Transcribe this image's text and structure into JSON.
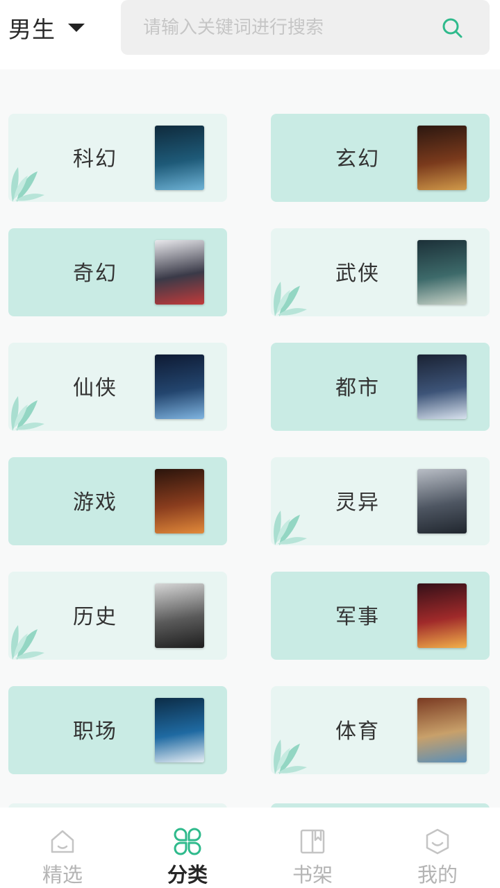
{
  "header": {
    "gender_label": "男生",
    "search_placeholder": "请输入关键词进行搜索"
  },
  "categories": [
    {
      "label": "科幻",
      "style": "light",
      "leaf": true
    },
    {
      "label": "玄幻",
      "style": "dark",
      "leaf": false
    },
    {
      "label": "奇幻",
      "style": "dark",
      "leaf": false
    },
    {
      "label": "武侠",
      "style": "light",
      "leaf": true
    },
    {
      "label": "仙侠",
      "style": "light",
      "leaf": true
    },
    {
      "label": "都市",
      "style": "dark",
      "leaf": false
    },
    {
      "label": "游戏",
      "style": "dark",
      "leaf": false
    },
    {
      "label": "灵异",
      "style": "light",
      "leaf": true
    },
    {
      "label": "历史",
      "style": "light",
      "leaf": true
    },
    {
      "label": "军事",
      "style": "dark",
      "leaf": false
    },
    {
      "label": "职场",
      "style": "dark",
      "leaf": false
    },
    {
      "label": "体育",
      "style": "light",
      "leaf": true
    }
  ],
  "nav": [
    {
      "label": "精选",
      "icon": "home-icon",
      "active": false
    },
    {
      "label": "分类",
      "icon": "category-icon",
      "active": true
    },
    {
      "label": "书架",
      "icon": "bookshelf-icon",
      "active": false
    },
    {
      "label": "我的",
      "icon": "profile-icon",
      "active": false
    }
  ],
  "colors": {
    "accent": "#2fba8c",
    "card_light": "#e8f5f2",
    "card_dark": "#c9ebe4",
    "leaf": "#8fd5c2",
    "nav_inactive": "#b4b4b4"
  }
}
